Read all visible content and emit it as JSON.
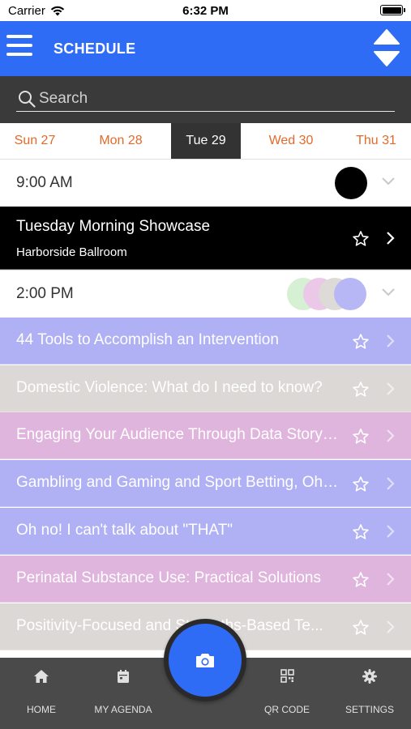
{
  "status_bar": {
    "carrier": "Carrier",
    "time": "6:32 PM"
  },
  "header": {
    "title": "SCHEDULE"
  },
  "search": {
    "placeholder": "Search"
  },
  "days": [
    {
      "label": "Sun 27",
      "active": false
    },
    {
      "label": "Mon 28",
      "active": false
    },
    {
      "label": "Tue 29",
      "active": true
    },
    {
      "label": "Wed 30",
      "active": false
    },
    {
      "label": "Thu 31",
      "active": false
    }
  ],
  "time_groups": [
    {
      "time": "9:00 AM",
      "dot_colors": [
        "#000000"
      ]
    },
    {
      "time": "2:00 PM",
      "dot_colors": [
        "#d5f0d3",
        "#ecc8e8",
        "#dedad8",
        "#b7b7f6"
      ]
    }
  ],
  "featured_session": {
    "title": "Tuesday Morning Showcase",
    "location": "Harborside Ballroom",
    "color": "#000000"
  },
  "sessions": [
    {
      "title": "44 Tools to Accomplish an Intervention",
      "color": "#b0b0f5"
    },
    {
      "title": "Domestic Violence: What do I need to know?",
      "color": "#dcd8d5"
    },
    {
      "title": "Engaging Your Audience Through Data Storytelling",
      "color": "#dfb5dd"
    },
    {
      "title": "Gambling and Gaming and Sport Betting, Oh My!",
      "color": "#b0b0f5"
    },
    {
      "title": "Oh no! I can't talk about \"THAT\"",
      "color": "#b0b0f5"
    },
    {
      "title": "Perinatal Substance Use: Practical Solutions",
      "color": "#dfb5dd"
    },
    {
      "title": "Positivity-Focused and Strengths-Based Te...",
      "color": "#dcd8d5"
    }
  ],
  "tab_bar": {
    "home": "HOME",
    "agenda": "MY AGENDA",
    "qr": "QR CODE",
    "settings": "SETTINGS"
  },
  "colors": {
    "accent": "#2f6cf5",
    "day_inactive": "#e36a2a",
    "search_bg": "#3a3a3a",
    "tabbar_bg": "#4a4a4a"
  }
}
